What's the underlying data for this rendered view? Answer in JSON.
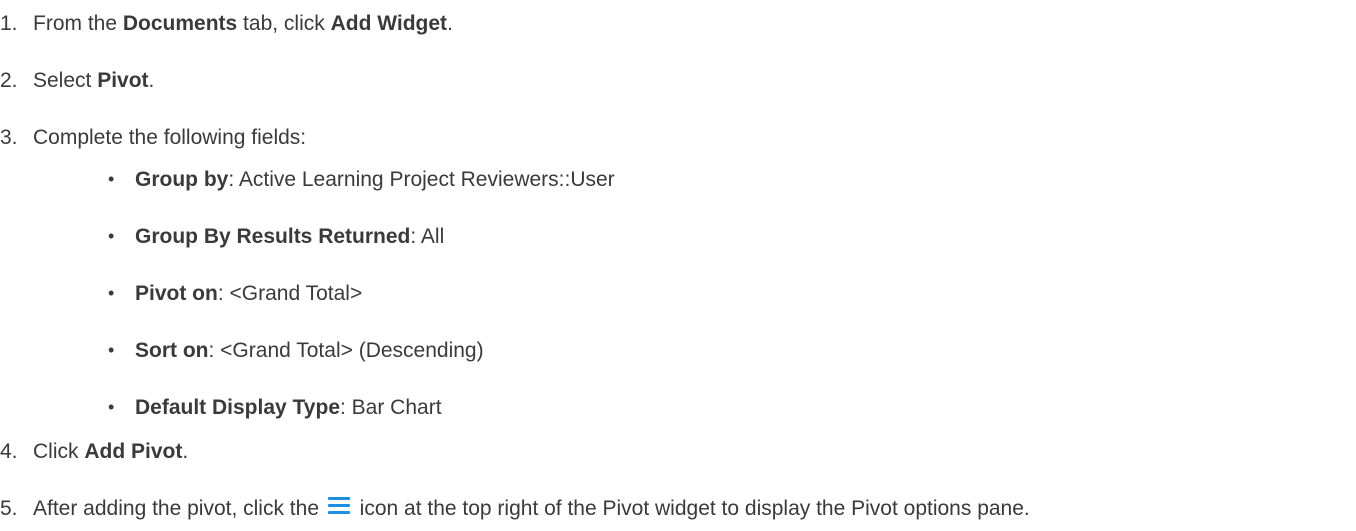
{
  "steps": [
    {
      "num": "1.",
      "pre": "From the ",
      "b1": "Documents",
      "mid": " tab, click ",
      "b2": "Add Widget",
      "post": "."
    },
    {
      "num": "2.",
      "pre": "Select ",
      "b1": "Pivot",
      "post": "."
    },
    {
      "num": "3.",
      "text": "Complete the following fields:"
    },
    {
      "num": "4.",
      "pre": "Click ",
      "b1": "Add Pivot",
      "post": "."
    },
    {
      "num": "5.",
      "pre": "After adding the pivot, click the ",
      "post": " icon at the top right of the Pivot widget to display the Pivot options pane."
    }
  ],
  "fields": [
    {
      "bullet": "•",
      "label": "Group by",
      "sep": ": ",
      "value": "Active Learning Project Reviewers::User"
    },
    {
      "bullet": "•",
      "label": "Group By Results Returned",
      "sep": ": ",
      "value": "All"
    },
    {
      "bullet": "•",
      "label": "Pivot on",
      "sep": ": ",
      "value": "<Grand Total>"
    },
    {
      "bullet": "•",
      "label": "Sort on",
      "sep": ": ",
      "value": "<Grand Total> (Descending)"
    },
    {
      "bullet": "•",
      "label": "Default Display Type",
      "sep": ": ",
      "value": "Bar Chart"
    }
  ],
  "icons": {
    "menu_icon": "hamburger-menu-icon",
    "menu_icon_color": "#1c8fe0"
  }
}
